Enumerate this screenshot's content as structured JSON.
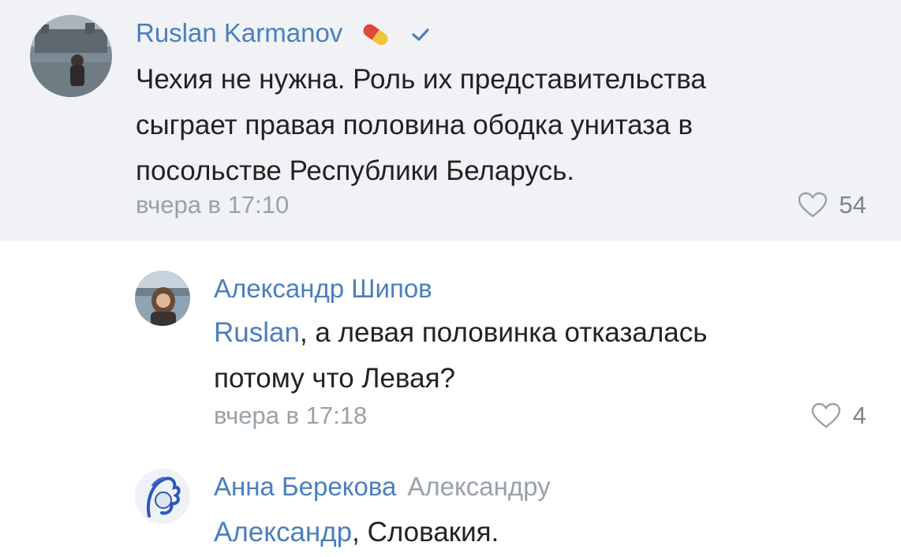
{
  "comments": [
    {
      "author": "Ruslan Karmanov",
      "badges": [
        "pill-icon",
        "verified-check-icon"
      ],
      "lines": [
        "Чехия не нужна. Роль их представительства",
        "сыграет правая половина ободка унитаза в",
        "посольстве Республики Беларусь."
      ],
      "time": "вчера в 17:10",
      "likes": "54"
    },
    {
      "author": "Александр Шипов",
      "mention": "Ruslan",
      "line1_rest": ", а левая половинка отказалась",
      "line2": "потому что Левая?",
      "time": "вчера в 17:18",
      "likes": "4"
    },
    {
      "author": "Анна Берекова",
      "reply_to": "Александру",
      "mention": "Александр",
      "text_rest": ", Словакия."
    }
  ],
  "colors": {
    "link": "#4a7fbe",
    "muted": "#9aa1a9",
    "highlight_bg": "#f0f2f5"
  }
}
